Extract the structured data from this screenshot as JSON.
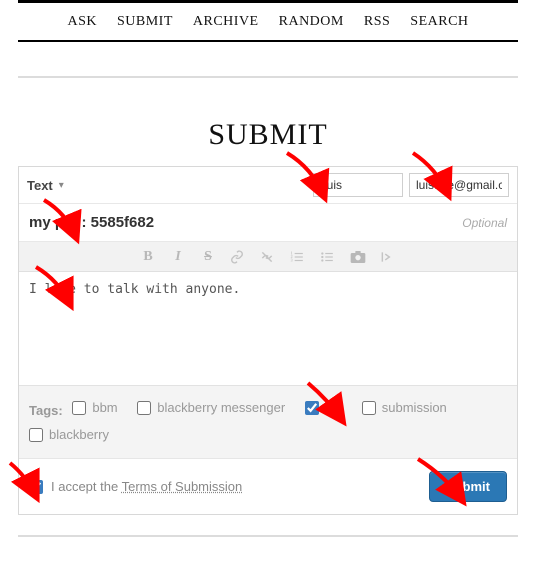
{
  "nav": {
    "items": [
      "ASK",
      "SUBMIT",
      "ARCHIVE",
      "RANDOM",
      "RSS",
      "SEARCH"
    ]
  },
  "page_title": "SUBMIT",
  "form": {
    "type_label": "Text",
    "name_value": "Luis",
    "email_value": "luisttee@gmail.c",
    "title_value": "my pin : 5585f682",
    "optional_label": "Optional",
    "body_value": "I love to talk with anyone."
  },
  "tags": {
    "label": "Tags:",
    "items": [
      {
        "label": "bbm",
        "checked": false
      },
      {
        "label": "blackberry messenger",
        "checked": false
      },
      {
        "label": "pin",
        "checked": true
      },
      {
        "label": "submission",
        "checked": false
      },
      {
        "label": "blackberry",
        "checked": false
      }
    ]
  },
  "accept": {
    "checked": true,
    "prefix": "I accept the ",
    "link": "Terms of Submission"
  },
  "submit_label": "Submit"
}
